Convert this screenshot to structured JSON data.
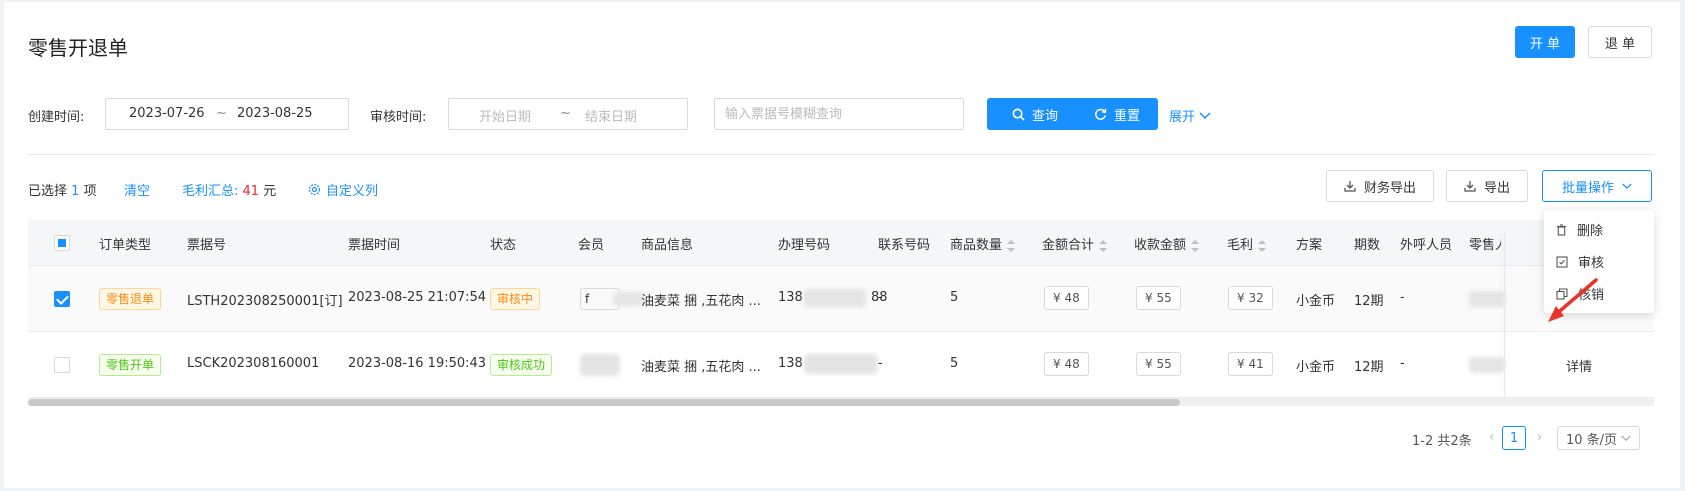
{
  "header": {
    "title": "零售开退单",
    "open_label": "开 单",
    "return_label": "退 单"
  },
  "filters": {
    "created_label": "创建时间:",
    "created_start": "2023-07-26",
    "created_sep": "~",
    "created_end": "2023-08-25",
    "audit_label": "审核时间:",
    "audit_start_placeholder": "开始日期",
    "audit_sep": "~",
    "audit_end_placeholder": "结束日期",
    "search_placeholder": "输入票据号模糊查询",
    "query_label": "查询",
    "reset_label": "重置",
    "expand_label": "展开"
  },
  "toolbar": {
    "selected_prefix": "已选择",
    "selected_count": "1",
    "selected_suffix": "项",
    "clear_label": "清空",
    "profit_label": "毛利汇总:",
    "profit_value": "41",
    "profit_unit": "元",
    "custom_columns_label": "自定义列",
    "finance_export_label": "财务导出",
    "export_label": "导出",
    "batch_label": "批量操作"
  },
  "batch_menu": [
    {
      "label": "删除",
      "icon": "trash-icon"
    },
    {
      "label": "审核",
      "icon": "check-square-icon"
    },
    {
      "label": "核销",
      "icon": "copy-icon"
    }
  ],
  "table": {
    "columns": [
      "订单类型",
      "票据号",
      "票据时间",
      "状态",
      "会员",
      "商品信息",
      "办理号码",
      "联系号码",
      "商品数量",
      "金额合计",
      "收款金额",
      "毛利",
      "方案",
      "期数",
      "外呼人员",
      "零售人"
    ],
    "rows": [
      {
        "type": "零售退单",
        "type_color": "orange",
        "ticket": "LSTH202308250001[订]",
        "time": "2023-08-25 21:07:54",
        "status": "审核中",
        "status_color": "orange",
        "member": "f",
        "product": "油麦菜 捆 ,五花肉 ...",
        "phone_prefix": "138",
        "phone_suffix": "88",
        "contact": "-",
        "qty": "5",
        "total": "¥ 48",
        "received": "¥ 55",
        "profit": "¥ 32",
        "plan": "小金币",
        "periods": "12期",
        "caller": "-",
        "action": ""
      },
      {
        "type": "零售开单",
        "type_color": "green",
        "ticket": "LSCK202308160001",
        "time": "2023-08-16 19:50:43",
        "status": "审核成功",
        "status_color": "green",
        "member": "",
        "product": "油麦菜 捆 ,五花肉 ...",
        "phone_prefix": "138",
        "phone_suffix": "",
        "contact": "-",
        "qty": "5",
        "total": "¥ 48",
        "received": "¥ 55",
        "profit": "¥ 41",
        "plan": "小金币",
        "periods": "12期",
        "caller": "-",
        "action": "详情"
      }
    ]
  },
  "pagination": {
    "summary": "1-2 共2条",
    "current_page": "1",
    "page_size": "10 条/页"
  },
  "colors": {
    "primary": "#1890ff",
    "danger": "#f5222d",
    "orange": "#fa8c16",
    "green": "#52c41a"
  }
}
